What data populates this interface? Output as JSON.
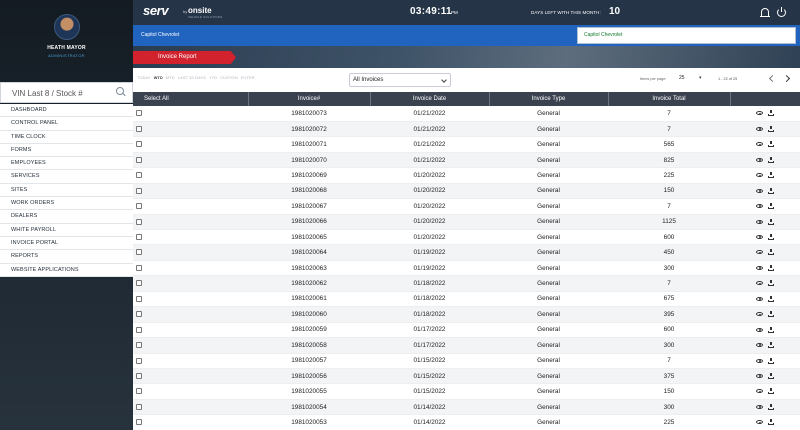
{
  "profile": {
    "name": "HEATH MAYOR",
    "role": "ADMINISTRATOR"
  },
  "search": {
    "placeholder": "VIN Last 8 / Stock #"
  },
  "menu": [
    "DASHBOARD",
    "CONTROL PANEL",
    "TIME CLOCK",
    "FORMS",
    "EMPLOYEES",
    "SERVICES",
    "SITES",
    "WORK ORDERS",
    "DEALERS",
    "WHITE PAYROLL",
    "INVOICE PORTAL",
    "REPORTS",
    "WEBSITE APPLICATIONS"
  ],
  "header": {
    "logo": "serv",
    "logo_by": "by",
    "logo_brand": "onsite",
    "logo_sub": "VEHICLE SOLUTIONS",
    "clock": "03:49:11",
    "ampm": "PM",
    "days_left_label": "DAYS LEFT WITH THIS MONTH:",
    "days_left_value": "10"
  },
  "dealer": {
    "name": "Capitol Chevrolet",
    "selected": "Capitol Chevrolet"
  },
  "banner": {
    "tab": "Invoice Report"
  },
  "filters": {
    "ranges": [
      "TODAY",
      "WTD",
      "MTD",
      "LAST 30 DAYS",
      "YTD",
      "CUSTOM",
      "FILTER"
    ],
    "active_range": 1,
    "invoice_filter": "All Invoices",
    "items_per_page_label": "Items per page:",
    "items_per_page": "25",
    "page_info": "1 - 22 of 25"
  },
  "table": {
    "headers": {
      "select_all": "Select All",
      "invoice": "Invoice#",
      "date": "Invoice Date",
      "type": "Invoice Type",
      "total": "Invoice Total"
    },
    "rows": [
      {
        "invoice": "1981020073",
        "date": "01/21/2022",
        "type": "General",
        "total": "7"
      },
      {
        "invoice": "1981020072",
        "date": "01/21/2022",
        "type": "General",
        "total": "7"
      },
      {
        "invoice": "1981020071",
        "date": "01/21/2022",
        "type": "General",
        "total": "565"
      },
      {
        "invoice": "1981020070",
        "date": "01/21/2022",
        "type": "General",
        "total": "825"
      },
      {
        "invoice": "1981020069",
        "date": "01/20/2022",
        "type": "General",
        "total": "225"
      },
      {
        "invoice": "1981020068",
        "date": "01/20/2022",
        "type": "General",
        "total": "150"
      },
      {
        "invoice": "1981020067",
        "date": "01/20/2022",
        "type": "General",
        "total": "7"
      },
      {
        "invoice": "1981020066",
        "date": "01/20/2022",
        "type": "General",
        "total": "1125"
      },
      {
        "invoice": "1981020065",
        "date": "01/20/2022",
        "type": "General",
        "total": "600"
      },
      {
        "invoice": "1981020064",
        "date": "01/19/2022",
        "type": "General",
        "total": "450"
      },
      {
        "invoice": "1981020063",
        "date": "01/19/2022",
        "type": "General",
        "total": "300"
      },
      {
        "invoice": "1981020062",
        "date": "01/18/2022",
        "type": "General",
        "total": "7"
      },
      {
        "invoice": "1981020061",
        "date": "01/18/2022",
        "type": "General",
        "total": "675"
      },
      {
        "invoice": "1981020060",
        "date": "01/18/2022",
        "type": "General",
        "total": "395"
      },
      {
        "invoice": "1981020059",
        "date": "01/17/2022",
        "type": "General",
        "total": "600"
      },
      {
        "invoice": "1981020058",
        "date": "01/17/2022",
        "type": "General",
        "total": "300"
      },
      {
        "invoice": "1981020057",
        "date": "01/15/2022",
        "type": "General",
        "total": "7"
      },
      {
        "invoice": "1981020056",
        "date": "01/15/2022",
        "type": "General",
        "total": "375"
      },
      {
        "invoice": "1981020055",
        "date": "01/15/2022",
        "type": "General",
        "total": "150"
      },
      {
        "invoice": "1981020054",
        "date": "01/14/2022",
        "type": "General",
        "total": "300"
      },
      {
        "invoice": "1981020053",
        "date": "01/14/2022",
        "type": "General",
        "total": "225"
      }
    ]
  }
}
